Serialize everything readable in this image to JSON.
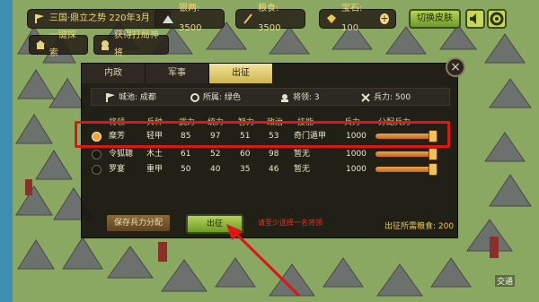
{
  "topbar": {
    "season": "三国·鼎立之势 220年3月",
    "silver": "银两: 3500",
    "grain": "粮食: 3500",
    "gems": "宝石: 100",
    "switch_skin": "切换皮肤"
  },
  "side": {
    "explore": "一键探索",
    "recruit": "获得打局神将"
  },
  "tabs": [
    "内政",
    "军事",
    "出征"
  ],
  "info": {
    "city": "城池: 成都",
    "belong": "所属: 绿色",
    "generals": "将领: 3",
    "troops": "兵力: 500"
  },
  "table": {
    "headers": [
      "将领",
      "兵种",
      "武力",
      "统力",
      "智力",
      "政治",
      "技能",
      "兵力",
      "分配兵力"
    ],
    "rows": [
      {
        "name": "糜芳",
        "type": "轻甲",
        "wu": "85",
        "tong": "97",
        "zhi": "51",
        "zheng": "53",
        "skill": "奇门遁甲",
        "troops": "1000",
        "alloc": 0.95,
        "selected": true
      },
      {
        "name": "令狐聰",
        "type": "木土",
        "wu": "61",
        "tong": "52",
        "zhi": "60",
        "zheng": "98",
        "skill": "暂无",
        "troops": "1000",
        "alloc": 0.95,
        "selected": false
      },
      {
        "name": "罗宴",
        "type": "重甲",
        "wu": "50",
        "tong": "40",
        "zhi": "35",
        "zheng": "46",
        "skill": "暂无",
        "troops": "1000",
        "alloc": 0.95,
        "selected": false
      }
    ]
  },
  "buttons": {
    "save": "保存兵力分配",
    "go": "出征"
  },
  "hint": "请至少选择一名将领",
  "cost": "出征所需粮食: 200",
  "map_label": "交通",
  "colors": {
    "highlight": "#e01515",
    "accent": "#f2e39a"
  }
}
